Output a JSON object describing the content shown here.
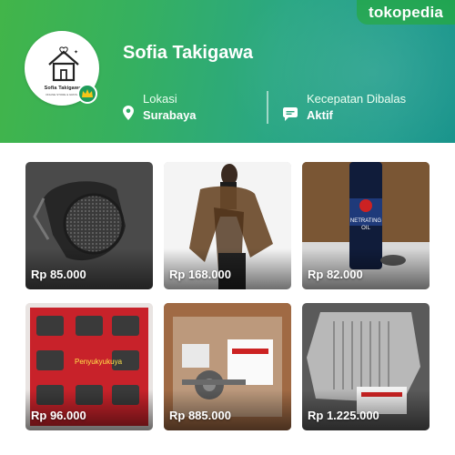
{
  "brand": {
    "name": "tokopedia",
    "color": "#42b549"
  },
  "shop": {
    "name": "Sofia Takigawa",
    "logo_text": "Sofia Takigawa",
    "logo_subtext": "ONLINE STORE & GROSIR",
    "location_label": "Lokasi",
    "location_value": "Surabaya",
    "response_label": "Kecepatan Dibalas",
    "response_value": "Aktif",
    "badge_icon": "crown-icon"
  },
  "products": [
    {
      "price": "Rp 85.000",
      "image": "motorcycle-part-mesh-image"
    },
    {
      "price": "Rp 168.000",
      "image": "woman-scarf-image"
    },
    {
      "price": "Rp 82.000",
      "image": "penetrating-oil-can-image"
    },
    {
      "price": "Rp 96.000",
      "image": "honda-brake-pads-image"
    },
    {
      "price": "Rp 885.000",
      "image": "crankshaft-parts-image"
    },
    {
      "price": "Rp 1.225.000",
      "image": "ecu-module-image"
    }
  ]
}
